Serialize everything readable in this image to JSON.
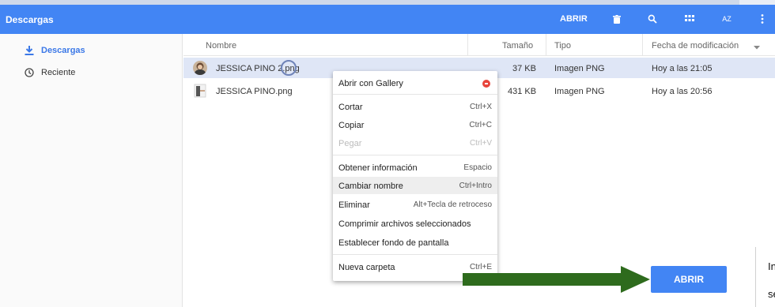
{
  "titlebar": {
    "title": "Descargas",
    "open_label": "ABRIR",
    "icons": [
      "trash-icon",
      "search-icon",
      "grid-view-icon",
      "sort-az-icon",
      "more-vert-icon"
    ],
    "sort_label": "AZ"
  },
  "sidebar": {
    "items": [
      {
        "label": "Descargas",
        "icon": "download-icon",
        "active": true
      },
      {
        "label": "Reciente",
        "icon": "clock-icon",
        "active": false
      }
    ]
  },
  "columns": {
    "name": "Nombre",
    "size": "Tamaño",
    "type": "Tipo",
    "modified": "Fecha de modificación"
  },
  "files": [
    {
      "name": "JESSICA PINO 2.png",
      "size": "37 KB",
      "type": "Imagen PNG",
      "modified": "Hoy a las 21:05",
      "selected": true
    },
    {
      "name": "JESSICA PINO.png",
      "size": "431 KB",
      "type": "Imagen PNG",
      "modified": "Hoy a las 20:56",
      "selected": false
    }
  ],
  "context_menu": {
    "open_with": "Abrir con Gallery",
    "cut": {
      "label": "Cortar",
      "shortcut": "Ctrl+X"
    },
    "copy": {
      "label": "Copiar",
      "shortcut": "Ctrl+C"
    },
    "paste": {
      "label": "Pegar",
      "shortcut": "Ctrl+V"
    },
    "info": {
      "label": "Obtener información",
      "shortcut": "Espacio"
    },
    "rename": {
      "label": "Cambiar nombre",
      "shortcut": "Ctrl+Intro"
    },
    "delete": {
      "label": "Eliminar",
      "shortcut": "Alt+Tecla de retroceso"
    },
    "compress": {
      "label": "Comprimir archivos seleccionados"
    },
    "wallpaper": {
      "label": "Establecer fondo de pantalla"
    },
    "new_folder": {
      "label": "Nueva carpeta",
      "shortcut": "Ctrl+E"
    }
  },
  "callout": {
    "button_label": "ABRIR",
    "side_text_1": "In",
    "side_text_2": "se"
  },
  "colors": {
    "accent": "#4285f4",
    "selected_row": "#dfe6f6",
    "arrow": "#2e6b1d"
  }
}
